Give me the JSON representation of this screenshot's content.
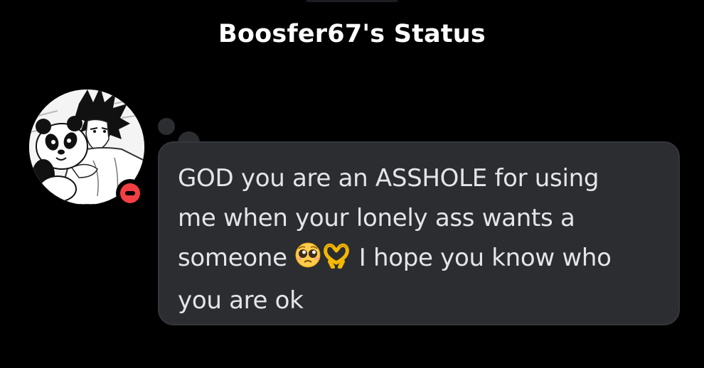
{
  "header": {
    "title": "Boosfer67's Status"
  },
  "profile": {
    "avatar_icon": "anime-avatar-with-panda",
    "status": "do-not-disturb",
    "status_color": "#f23f43"
  },
  "status_message": {
    "line1": "GOD you are an ASSHOLE for using",
    "line2": "me when your lonely ass wants a",
    "line3_before": "someone",
    "emoji1": "pleading-face-emoji",
    "emoji2": "heart-hands-emoji",
    "line3_after": "I hope you know who",
    "line4": "you are ok"
  },
  "colors": {
    "background": "#000000",
    "bubble": "#2b2d31",
    "text": "#e3e5e8",
    "title": "#ffffff"
  }
}
